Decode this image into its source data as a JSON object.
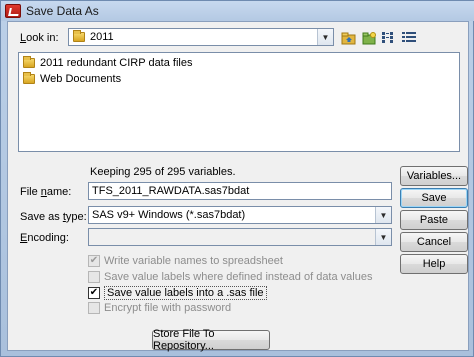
{
  "window": {
    "title": "Save Data As"
  },
  "look_in": {
    "label": "Look in:",
    "value": "2011"
  },
  "toolbar": {
    "icons": [
      "up-folder-icon",
      "new-folder-icon",
      "list-view-icon",
      "details-view-icon"
    ]
  },
  "files": [
    {
      "name": "2011 redundant CIRP data files",
      "icon": "folder-icon"
    },
    {
      "name": "Web Documents",
      "icon": "folder-icon"
    }
  ],
  "status": {
    "keeping_text": "Keeping 295 of 295 variables."
  },
  "file_name": {
    "label": "File name:",
    "value": "TFS_2011_RAWDATA.sas7bdat"
  },
  "save_as_type": {
    "label": "Save as type:",
    "value": "SAS v9+ Windows (*.sas7bdat)"
  },
  "encoding": {
    "label": "Encoding:",
    "value": ""
  },
  "options": [
    {
      "label": "Write variable names to spreadsheet",
      "checked": true,
      "enabled": false
    },
    {
      "label": "Save value labels where defined instead of data values",
      "checked": false,
      "enabled": false
    },
    {
      "label": "Save value labels into a .sas file",
      "checked": true,
      "enabled": true
    },
    {
      "label": "Encrypt file with password",
      "checked": false,
      "enabled": false
    }
  ],
  "buttons": {
    "variables": "Variables...",
    "save": "Save",
    "paste": "Paste",
    "cancel": "Cancel",
    "help": "Help",
    "store": "Store File To Repository..."
  }
}
